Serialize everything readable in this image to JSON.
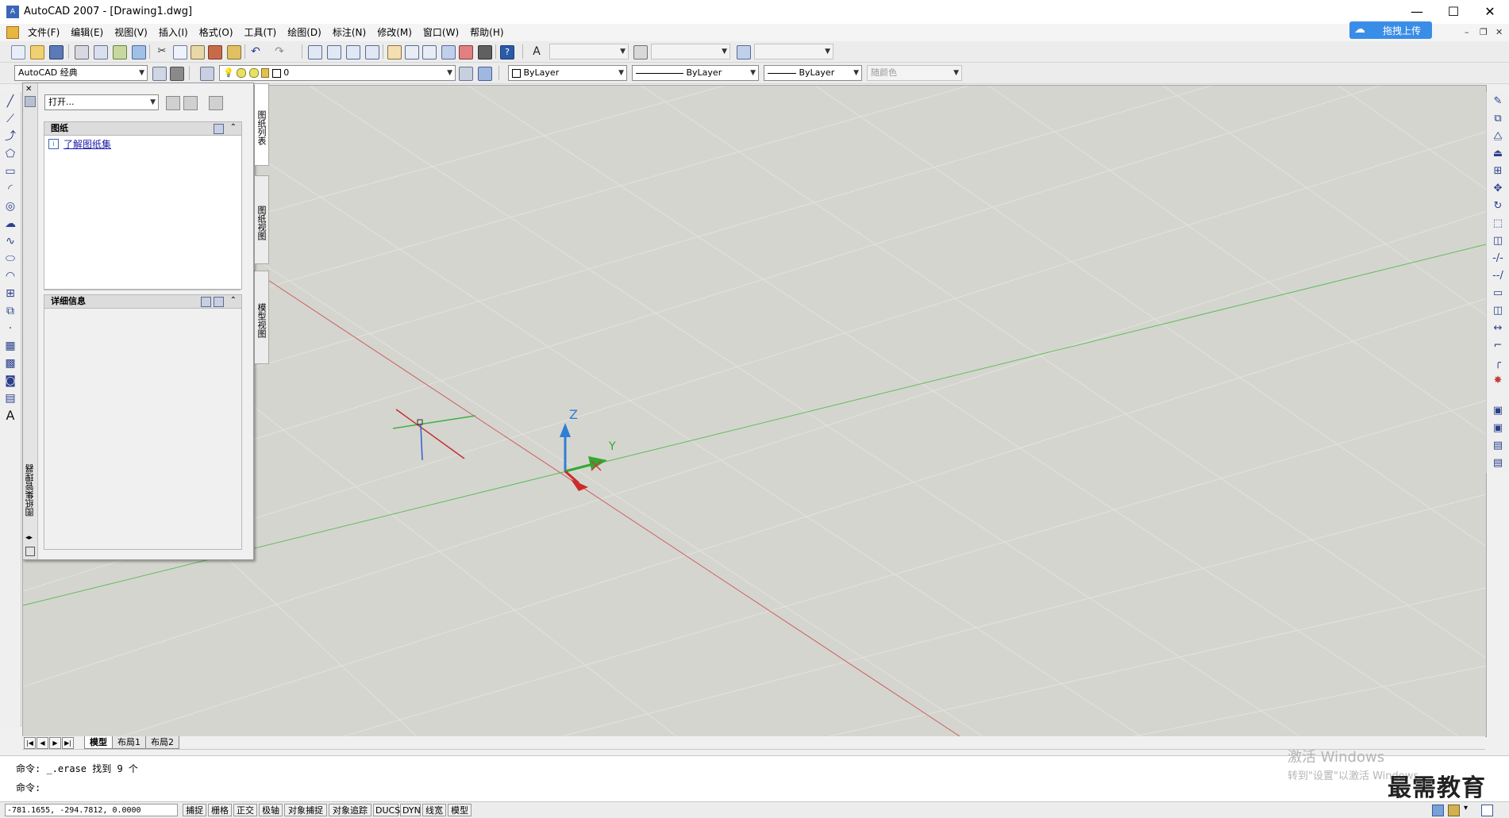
{
  "app": {
    "title": "AutoCAD 2007 - [Drawing1.dwg]"
  },
  "window_controls": {
    "minimize": "—",
    "maximize": "☐",
    "close": "✕"
  },
  "menu": {
    "items": [
      "文件(F)",
      "编辑(E)",
      "视图(V)",
      "插入(I)",
      "格式(O)",
      "工具(T)",
      "绘图(D)",
      "标注(N)",
      "修改(M)",
      "窗口(W)",
      "帮助(H)"
    ]
  },
  "upload": {
    "label": "拖拽上传"
  },
  "workspace": {
    "value": "AutoCAD 经典"
  },
  "layer": {
    "value": "0"
  },
  "properties": {
    "color": "ByLayer",
    "linetype": "ByLayer",
    "lineweight": "ByLayer",
    "plotstyle": "随颜色"
  },
  "sheetset_manager": {
    "strip_label": "图纸集管理器",
    "open_combo": "打开...",
    "sheets_header": "图纸",
    "sheets_link": "了解图纸集",
    "details_header": "详细信息",
    "tabs": [
      "图纸列表",
      "图纸视图",
      "模型视图"
    ]
  },
  "axes": {
    "x": "X",
    "y": "Y",
    "z": "Z"
  },
  "layout_tabs": [
    "模型",
    "布局1",
    "布局2"
  ],
  "command": {
    "history": "命令: _.erase 找到 9 个",
    "prompt": "命令:"
  },
  "watermark": {
    "line1": "激活 Windows",
    "line2": "转到\"设置\"以激活 Windows。",
    "brand": "最需教育"
  },
  "status": {
    "coords": "-781.1655,  -294.7812, 0.0000",
    "buttons": [
      "捕捉",
      "栅格",
      "正交",
      "极轴",
      "对象捕捉",
      "对象追踪",
      "DUCS",
      "DYN",
      "线宽",
      "模型"
    ]
  },
  "colors": {
    "canvas_bg": "#d5d5cf",
    "x_axis": "#cc3b3b",
    "y_axis": "#3bb23b",
    "z_axis": "#2f7fd6",
    "upload_btn": "#3a8de6"
  }
}
